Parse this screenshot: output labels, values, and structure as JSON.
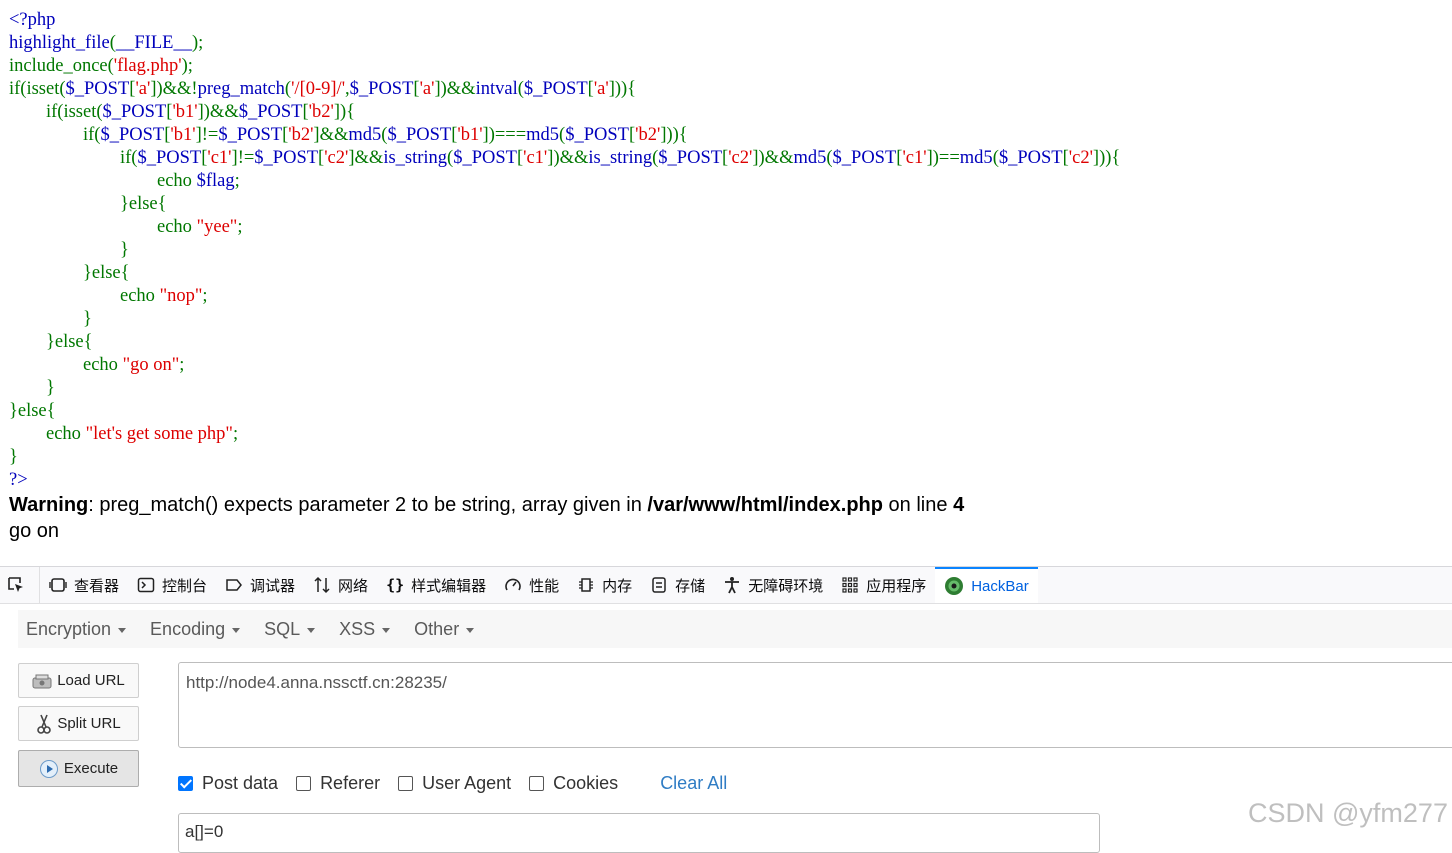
{
  "code_lines": [
    [
      {
        "t": "<?php",
        "c": "blue"
      }
    ],
    [
      {
        "t": "highlight_file",
        "c": "blue"
      },
      {
        "t": "(",
        "c": "green"
      },
      {
        "t": "__FILE__",
        "c": "blue"
      },
      {
        "t": ");",
        "c": "green"
      }
    ],
    [
      {
        "t": "include_once(",
        "c": "green"
      },
      {
        "t": "'flag.php'",
        "c": "red"
      },
      {
        "t": ");",
        "c": "green"
      }
    ],
    [
      {
        "t": "if(isset(",
        "c": "green"
      },
      {
        "t": "$_POST",
        "c": "blue"
      },
      {
        "t": "[",
        "c": "green"
      },
      {
        "t": "'a'",
        "c": "red"
      },
      {
        "t": "])&&!",
        "c": "green"
      },
      {
        "t": "preg_match",
        "c": "blue"
      },
      {
        "t": "(",
        "c": "green"
      },
      {
        "t": "'/[0-9]/'",
        "c": "red"
      },
      {
        "t": ",",
        "c": "green"
      },
      {
        "t": "$_POST",
        "c": "blue"
      },
      {
        "t": "[",
        "c": "green"
      },
      {
        "t": "'a'",
        "c": "red"
      },
      {
        "t": "])&&",
        "c": "green"
      },
      {
        "t": "intval",
        "c": "blue"
      },
      {
        "t": "(",
        "c": "green"
      },
      {
        "t": "$_POST",
        "c": "blue"
      },
      {
        "t": "[",
        "c": "green"
      },
      {
        "t": "'a'",
        "c": "red"
      },
      {
        "t": "])){",
        "c": "green"
      }
    ],
    [
      {
        "t": "        if(isset(",
        "c": "green"
      },
      {
        "t": "$_POST",
        "c": "blue"
      },
      {
        "t": "[",
        "c": "green"
      },
      {
        "t": "'b1'",
        "c": "red"
      },
      {
        "t": "])&&",
        "c": "green"
      },
      {
        "t": "$_POST",
        "c": "blue"
      },
      {
        "t": "[",
        "c": "green"
      },
      {
        "t": "'b2'",
        "c": "red"
      },
      {
        "t": "]){",
        "c": "green"
      }
    ],
    [
      {
        "t": "                if(",
        "c": "green"
      },
      {
        "t": "$_POST",
        "c": "blue"
      },
      {
        "t": "[",
        "c": "green"
      },
      {
        "t": "'b1'",
        "c": "red"
      },
      {
        "t": "]!=",
        "c": "green"
      },
      {
        "t": "$_POST",
        "c": "blue"
      },
      {
        "t": "[",
        "c": "green"
      },
      {
        "t": "'b2'",
        "c": "red"
      },
      {
        "t": "]&&",
        "c": "green"
      },
      {
        "t": "md5",
        "c": "blue"
      },
      {
        "t": "(",
        "c": "green"
      },
      {
        "t": "$_POST",
        "c": "blue"
      },
      {
        "t": "[",
        "c": "green"
      },
      {
        "t": "'b1'",
        "c": "red"
      },
      {
        "t": "])===",
        "c": "green"
      },
      {
        "t": "md5",
        "c": "blue"
      },
      {
        "t": "(",
        "c": "green"
      },
      {
        "t": "$_POST",
        "c": "blue"
      },
      {
        "t": "[",
        "c": "green"
      },
      {
        "t": "'b2'",
        "c": "red"
      },
      {
        "t": "])){",
        "c": "green"
      }
    ],
    [
      {
        "t": "                        if(",
        "c": "green"
      },
      {
        "t": "$_POST",
        "c": "blue"
      },
      {
        "t": "[",
        "c": "green"
      },
      {
        "t": "'c1'",
        "c": "red"
      },
      {
        "t": "]!=",
        "c": "green"
      },
      {
        "t": "$_POST",
        "c": "blue"
      },
      {
        "t": "[",
        "c": "green"
      },
      {
        "t": "'c2'",
        "c": "red"
      },
      {
        "t": "]&&",
        "c": "green"
      },
      {
        "t": "is_string",
        "c": "blue"
      },
      {
        "t": "(",
        "c": "green"
      },
      {
        "t": "$_POST",
        "c": "blue"
      },
      {
        "t": "[",
        "c": "green"
      },
      {
        "t": "'c1'",
        "c": "red"
      },
      {
        "t": "])&&",
        "c": "green"
      },
      {
        "t": "is_string",
        "c": "blue"
      },
      {
        "t": "(",
        "c": "green"
      },
      {
        "t": "$_POST",
        "c": "blue"
      },
      {
        "t": "[",
        "c": "green"
      },
      {
        "t": "'c2'",
        "c": "red"
      },
      {
        "t": "])&&",
        "c": "green"
      },
      {
        "t": "md5",
        "c": "blue"
      },
      {
        "t": "(",
        "c": "green"
      },
      {
        "t": "$_POST",
        "c": "blue"
      },
      {
        "t": "[",
        "c": "green"
      },
      {
        "t": "'c1'",
        "c": "red"
      },
      {
        "t": "])==",
        "c": "green"
      },
      {
        "t": "md5",
        "c": "blue"
      },
      {
        "t": "(",
        "c": "green"
      },
      {
        "t": "$_POST",
        "c": "blue"
      },
      {
        "t": "[",
        "c": "green"
      },
      {
        "t": "'c2'",
        "c": "red"
      },
      {
        "t": "])){",
        "c": "green"
      }
    ],
    [
      {
        "t": "                                echo ",
        "c": "green"
      },
      {
        "t": "$flag",
        "c": "blue"
      },
      {
        "t": ";",
        "c": "green"
      }
    ],
    [
      {
        "t": "                        }else{",
        "c": "green"
      }
    ],
    [
      {
        "t": "                                echo ",
        "c": "green"
      },
      {
        "t": "\"yee\"",
        "c": "red"
      },
      {
        "t": ";",
        "c": "green"
      }
    ],
    [
      {
        "t": "                        }",
        "c": "green"
      }
    ],
    [
      {
        "t": "                }else{",
        "c": "green"
      }
    ],
    [
      {
        "t": "                        echo ",
        "c": "green"
      },
      {
        "t": "\"nop\"",
        "c": "red"
      },
      {
        "t": ";",
        "c": "green"
      }
    ],
    [
      {
        "t": "                }",
        "c": "green"
      }
    ],
    [
      {
        "t": "        }else{",
        "c": "green"
      }
    ],
    [
      {
        "t": "                echo ",
        "c": "green"
      },
      {
        "t": "\"go on\"",
        "c": "red"
      },
      {
        "t": ";",
        "c": "green"
      }
    ],
    [
      {
        "t": "        }",
        "c": "green"
      }
    ],
    [
      {
        "t": "}else{",
        "c": "green"
      }
    ],
    [
      {
        "t": "        echo ",
        "c": "green"
      },
      {
        "t": "\"let's get some php\"",
        "c": "red"
      },
      {
        "t": ";",
        "c": "green"
      }
    ],
    [
      {
        "t": "}",
        "c": "green"
      }
    ],
    [
      {
        "t": "?>",
        "c": "blue"
      }
    ]
  ],
  "warning": {
    "label": "Warning",
    "message": ": preg_match() expects parameter 2 to be string, array given in ",
    "file": "/var/www/html/index.php",
    "on_line": " on line ",
    "line_no": "4"
  },
  "output": "go on",
  "devtools": {
    "tabs": [
      {
        "label": "查看器",
        "icon": "inspector-icon"
      },
      {
        "label": "控制台",
        "icon": "console-icon"
      },
      {
        "label": "调试器",
        "icon": "debugger-icon"
      },
      {
        "label": "网络",
        "icon": "network-icon"
      },
      {
        "label": "样式编辑器",
        "icon": "style-editor-icon"
      },
      {
        "label": "性能",
        "icon": "performance-icon"
      },
      {
        "label": "内存",
        "icon": "memory-icon"
      },
      {
        "label": "存储",
        "icon": "storage-icon"
      },
      {
        "label": "无障碍环境",
        "icon": "accessibility-icon"
      },
      {
        "label": "应用程序",
        "icon": "application-icon"
      },
      {
        "label": "HackBar",
        "icon": "hackbar-icon"
      }
    ],
    "active_tab": "HackBar",
    "accent_color": "#0a84ff"
  },
  "hackbar": {
    "menu": [
      "Encryption",
      "Encoding",
      "SQL",
      "XSS",
      "Other"
    ],
    "buttons": {
      "load": "Load URL",
      "split": "Split URL",
      "execute": "Execute"
    },
    "url": "http://node4.anna.nssctf.cn:28235/",
    "options": [
      {
        "label": "Post data",
        "checked": true
      },
      {
        "label": "Referer",
        "checked": false
      },
      {
        "label": "User Agent",
        "checked": false
      },
      {
        "label": "Cookies",
        "checked": false
      }
    ],
    "clear_all": "Clear All",
    "post_data": "a[]=0"
  },
  "watermark": "CSDN @yfm277"
}
